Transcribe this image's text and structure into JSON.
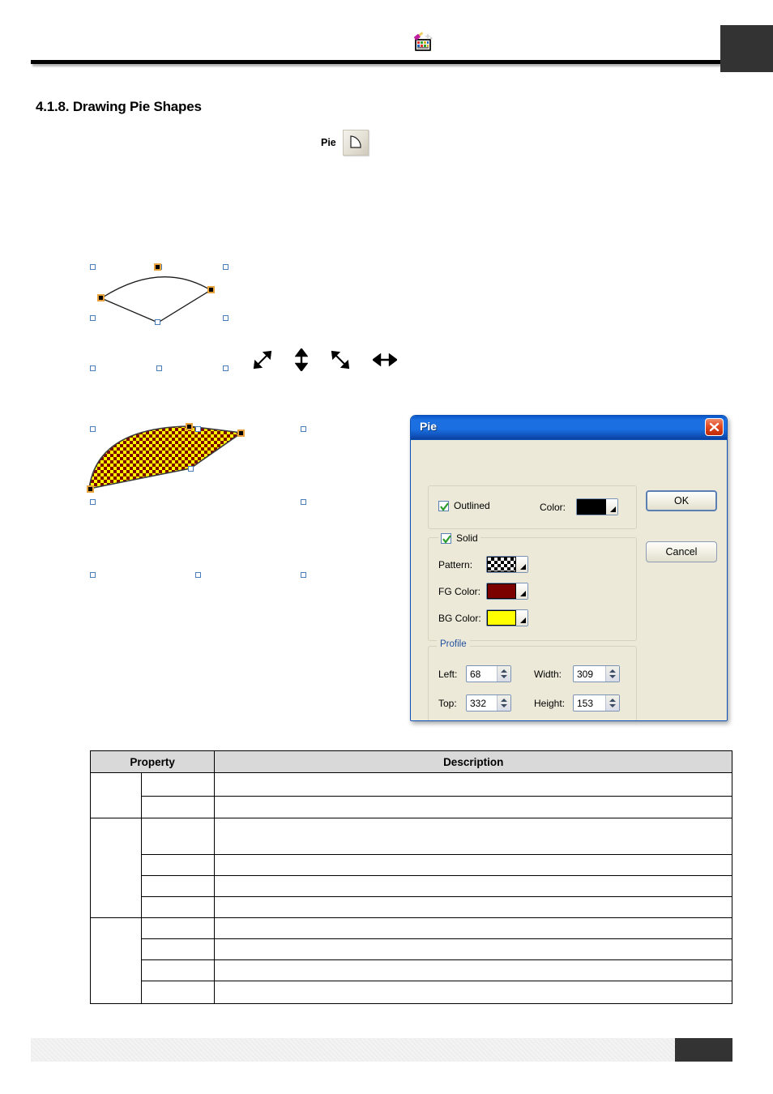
{
  "header": {
    "logo_icon": "paint-palette-icon",
    "rule": "horizontal-rule",
    "corner_block": ""
  },
  "section": {
    "title": "4.1.8. Drawing Pie Shapes"
  },
  "tool": {
    "label": "Pie",
    "icon": "pie-shape-tool-icon"
  },
  "illustration": {
    "outline_shape": "pie-outline-shape",
    "filled_shape": "pie-filled-shape",
    "cursors": [
      {
        "name": "resize-diagonal-ne-sw-cursor"
      },
      {
        "name": "resize-vertical-cursor"
      },
      {
        "name": "resize-diagonal-nw-se-cursor"
      },
      {
        "name": "resize-horizontal-cursor"
      }
    ]
  },
  "dialog": {
    "title": "Pie",
    "close_label": "×",
    "outlined": {
      "checkbox_label": "Outlined",
      "checked": true,
      "color_label": "Color:",
      "color_value": "#000000"
    },
    "solid": {
      "checkbox_label": "Solid",
      "checked": true,
      "pattern_label": "Pattern:",
      "pattern_value": "checkerboard",
      "fg_label": "FG Color:",
      "fg_value": "#7B0000",
      "bg_label": "BG Color:",
      "bg_value": "#FFFF00"
    },
    "profile": {
      "legend": "Profile",
      "left_label": "Left:",
      "left_value": "68",
      "top_label": "Top:",
      "top_value": "332",
      "width_label": "Width:",
      "width_value": "309",
      "height_label": "Height:",
      "height_value": "153"
    },
    "buttons": {
      "ok": "OK",
      "cancel": "Cancel"
    }
  },
  "table": {
    "headers": [
      "Property",
      "Description"
    ],
    "groups": [
      {
        "rows": [
          {
            "sub": "",
            "desc": ""
          },
          {
            "sub": "",
            "desc": ""
          }
        ]
      },
      {
        "rows": [
          {
            "sub": "",
            "desc": ""
          },
          {
            "sub": "",
            "desc": ""
          },
          {
            "sub": "",
            "desc": ""
          },
          {
            "sub": "",
            "desc": ""
          }
        ]
      },
      {
        "rows": [
          {
            "sub": "",
            "desc": ""
          },
          {
            "sub": "",
            "desc": ""
          },
          {
            "sub": "",
            "desc": ""
          },
          {
            "sub": "",
            "desc": ""
          }
        ]
      }
    ]
  },
  "footer": {
    "bar": "",
    "block": ""
  }
}
